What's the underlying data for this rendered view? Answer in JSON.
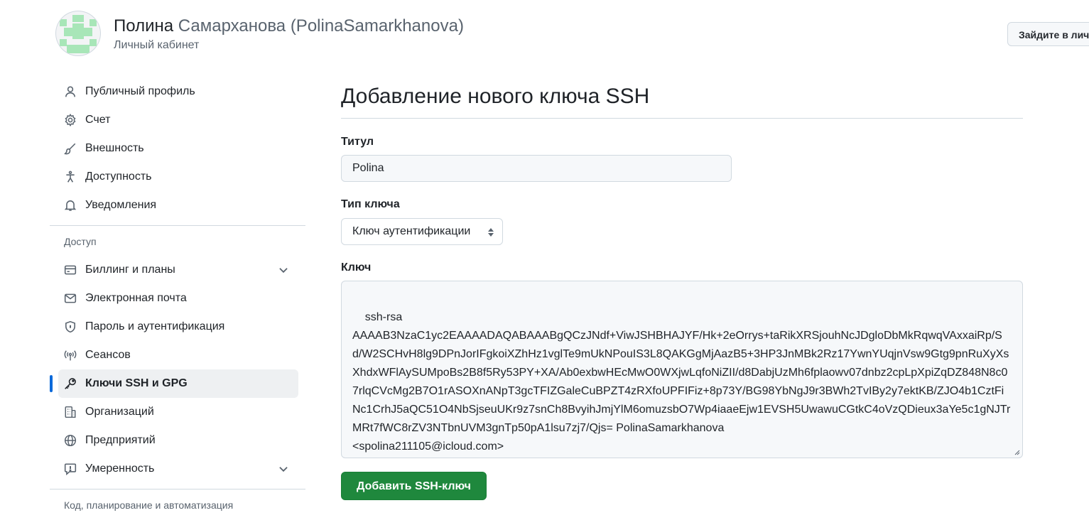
{
  "header": {
    "display_name": "Полина",
    "display_rest": "Самарханова (PolinaSamarkhanova)",
    "subtitle": "Личный кабинет",
    "go_button": "Зайдите в лич"
  },
  "sidebar": {
    "items": [
      {
        "label": "Публичный профиль",
        "icon": "person-icon"
      },
      {
        "label": "Счет",
        "icon": "gear-icon"
      },
      {
        "label": "Внешность",
        "icon": "paintbrush-icon"
      },
      {
        "label": "Доступность",
        "icon": "accessibility-icon"
      },
      {
        "label": "Уведомления",
        "icon": "bell-icon"
      }
    ],
    "access_header": "Доступ",
    "access_items": [
      {
        "label": "Биллинг и планы",
        "icon": "credit-card-icon",
        "expandable": true
      },
      {
        "label": "Электронная почта",
        "icon": "mail-icon"
      },
      {
        "label": "Пароль и аутентификация",
        "icon": "shield-icon"
      },
      {
        "label": "Сеансов",
        "icon": "broadcast-icon"
      },
      {
        "label": "Ключи SSH и GPG",
        "icon": "key-icon",
        "active": true
      },
      {
        "label": "Организаций",
        "icon": "organization-icon"
      },
      {
        "label": "Предприятий",
        "icon": "globe-icon"
      },
      {
        "label": "Умеренность",
        "icon": "report-icon",
        "expandable": true
      }
    ],
    "code_header": "Код, планирование и автоматизация"
  },
  "main": {
    "title": "Добавление нового ключа SSH",
    "title_label": "Титул",
    "title_value": "Polina",
    "key_type_label": "Тип ключа",
    "key_type_value": "Ключ аутентификации",
    "key_label": "Ключ",
    "key_value": "ssh-rsa\nAAAAB3NzaC1yc2EAAAADAQABAAABgQCzJNdf+ViwJSHBHAJYF/Hk+2eOrrys+taRikXRSjouhNcJDgloDbMkRqwqVAxxaiRp/Sd/W2SCHvH8lg9DPnJorIFgkoiXZhHz1vglTe9mUkNPouIS3L8QAKGgMjAazB5+3HP3JnMBk2Rz17YwnYUqjnVsw9Gtg9pnRuXyXsXhdxWFlAySUMpoBs2B8f5Ry53PY+XA/Ab0exbwHEcMwO0WXjwLqfoNiZII/d8DabjUzMh6fplaowv07dnbz2cpLpXpiZqDZ848N8c07rlqCVcMg2B7O1rASOXnANpT3gcTFIZGaleCuBPZT4zRXfoUPFIFiz+8p73Y/BG98YbNgJ9r3BWh2TvIBy2y7ektKB/ZJO4b1CztFiNc1CrhJ5aQC51O4NbSjseuUKr9z7snCh8BvyihJmjYlM6omuzsbO7Wp4iaaeEjw1EVSH5UwawuCGtkC4oVzQDieux3aYe5c1gNJTrMRt7fWC8rZV3NTbnUVM3gnTp50pA1lsu7zj7/Qjs= PolinaSamarkhanova\n<spolina211105@icloud.com>",
    "submit_label": "Добавить SSH-ключ"
  },
  "colors": {
    "accent": "#0969da",
    "primary_button": "#1f883d",
    "avatar": "#a8e6b8"
  }
}
